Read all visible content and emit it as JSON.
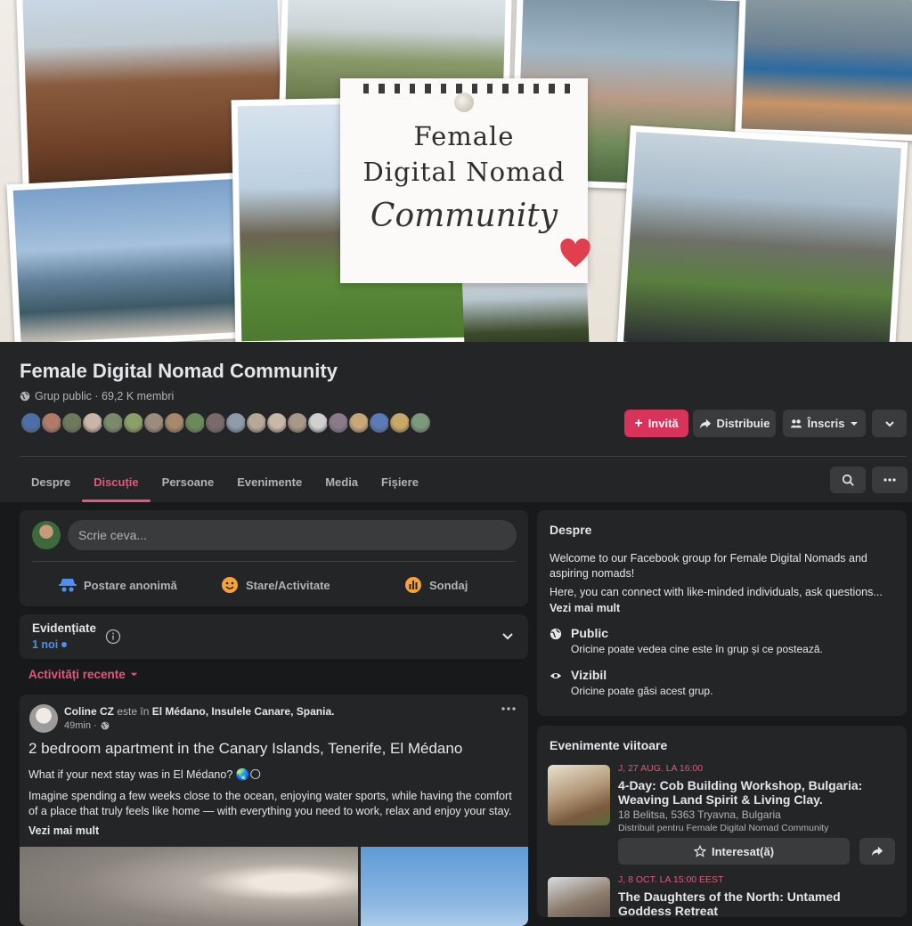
{
  "cover": {
    "line1": "Female",
    "line2": "Digital Nomad",
    "line3": "Community"
  },
  "group": {
    "title": "Female Digital Nomad Community",
    "meta": "Grup public · 69,2 K membri",
    "member_avatar_colors": [
      "#4d6fa8",
      "#b07a6a",
      "#6a7a5a",
      "#c9b6a8",
      "#7a8a6a",
      "#8aa066",
      "#9c8c7c",
      "#a8886a",
      "#6a8a5a",
      "#7a6a6a",
      "#8c9ca8",
      "#b8a898",
      "#c8b8a8",
      "#a89888",
      "#d0d0d0",
      "#8a7a8a",
      "#c8a878",
      "#5a7ab8",
      "#c8a868",
      "#7a9a7a"
    ]
  },
  "actions": {
    "invite": "Invită",
    "share": "Distribuie",
    "join": "Înscris"
  },
  "tabs": [
    "Despre",
    "Discuție",
    "Persoane",
    "Evenimente",
    "Media",
    "Fișiere"
  ],
  "composer": {
    "placeholder": "Scrie ceva...",
    "anon": "Postare anonimă",
    "feeling": "Stare/Activitate",
    "poll": "Sondaj"
  },
  "highlights": {
    "title": "Evidențiate",
    "sub": "1 noi"
  },
  "recent": "Activități recente",
  "post": {
    "author": "Coline CZ",
    "in_text": "este în",
    "location": "El Médano, Insulele Canare, Spania.",
    "time": "49min ·",
    "title": "2 bedroom apartment in the Canary Islands, Tenerife, El Médano",
    "p1": "What if your next stay was in El Médano? 🌏🌕",
    "p2": "Imagine spending a few weeks close to the ocean, enjoying water sports, while having the comfort of a place that truly feels like home — with everything you need to work, relax and enjoy your stay.",
    "more": "Vezi mai mult"
  },
  "about": {
    "title": "Despre",
    "p1": "Welcome to our Facebook group for Female Digital Nomads and aspiring nomads!",
    "p2": "Here, you can connect with like-minded individuals, ask questions...",
    "more": "Vezi mai mult",
    "public_title": "Public",
    "public_desc": "Oricine poate vedea cine este în grup și ce postează.",
    "visible_title": "Vizibil",
    "visible_desc": "Oricine poate găsi acest grup."
  },
  "events": {
    "title": "Evenimente viitoare",
    "e1_date": "J, 27 AUG. LA 16:00",
    "e1_title": "4-Day: Cob Building Workshop, Bulgaria: Weaving Land Spirit & Living Clay.",
    "e1_loc": "18 Belitsa, 5363 Tryavna, Bulgaria",
    "e1_dist": "Distribuit pentru Female Digital Nomad Community",
    "interested": "Interesat(ă)",
    "e2_date": "J, 8 OCT. LA 15:00 EEST",
    "e2_title": "The Daughters of the North: Untamed Goddess Retreat"
  },
  "colors": {
    "accent": "#e3587b",
    "invite": "#d8335a",
    "link": "#4e8ff0"
  }
}
